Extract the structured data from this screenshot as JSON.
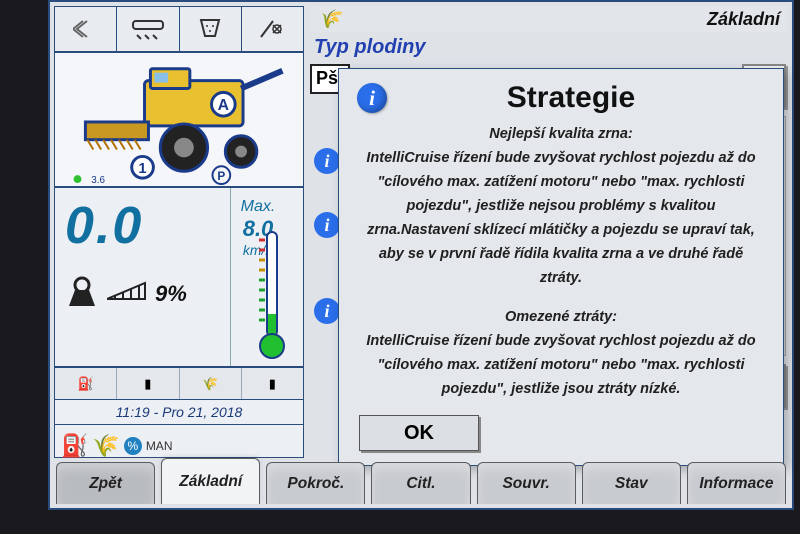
{
  "titlebar": {
    "title": "Základní"
  },
  "content": {
    "section_label": "Typ plodiny",
    "field_prefix": "Pš"
  },
  "speed": {
    "value": "0.0",
    "max_label": "Max.",
    "max_value": "8.0",
    "unit": "km/h",
    "load_pct": "9%"
  },
  "timestamp": "11:19 - Pro 21, 2018",
  "manual_label": "MAN",
  "perc_label": "%",
  "dialog": {
    "title": "Strategie",
    "section1_heading": "Nejlepší kvalita zrna:",
    "section1_body": "IntelliCruise řízení bude zvyšovat rychlost pojezdu až do \"cílového max. zatížení motoru\" nebo \"max. rychlosti pojezdu\", jestliže nejsou problémy s kvalitou zrna.Nastavení sklízecí mlátičky a pojezdu se upraví tak, aby se v první řadě řídila kvalita zrna a ve druhé řadě ztráty.",
    "section2_heading": "Omezené ztráty:",
    "section2_body": "IntelliCruise řízení bude zvyšovat rychlost pojezdu až do \"cílového max. zatížení motoru\" nebo \"max. rychlosti pojezdu\", jestliže jsou ztráty nízké.",
    "ok_label": "OK"
  },
  "tabs": {
    "back": "Zpět",
    "basic": "Základní",
    "advanced": "Pokroč.",
    "sensitivity": "Citl.",
    "related": "Souvr.",
    "status": "Stav",
    "info": "Informace"
  },
  "icons": {
    "info": "i",
    "indicator": "3.6"
  }
}
